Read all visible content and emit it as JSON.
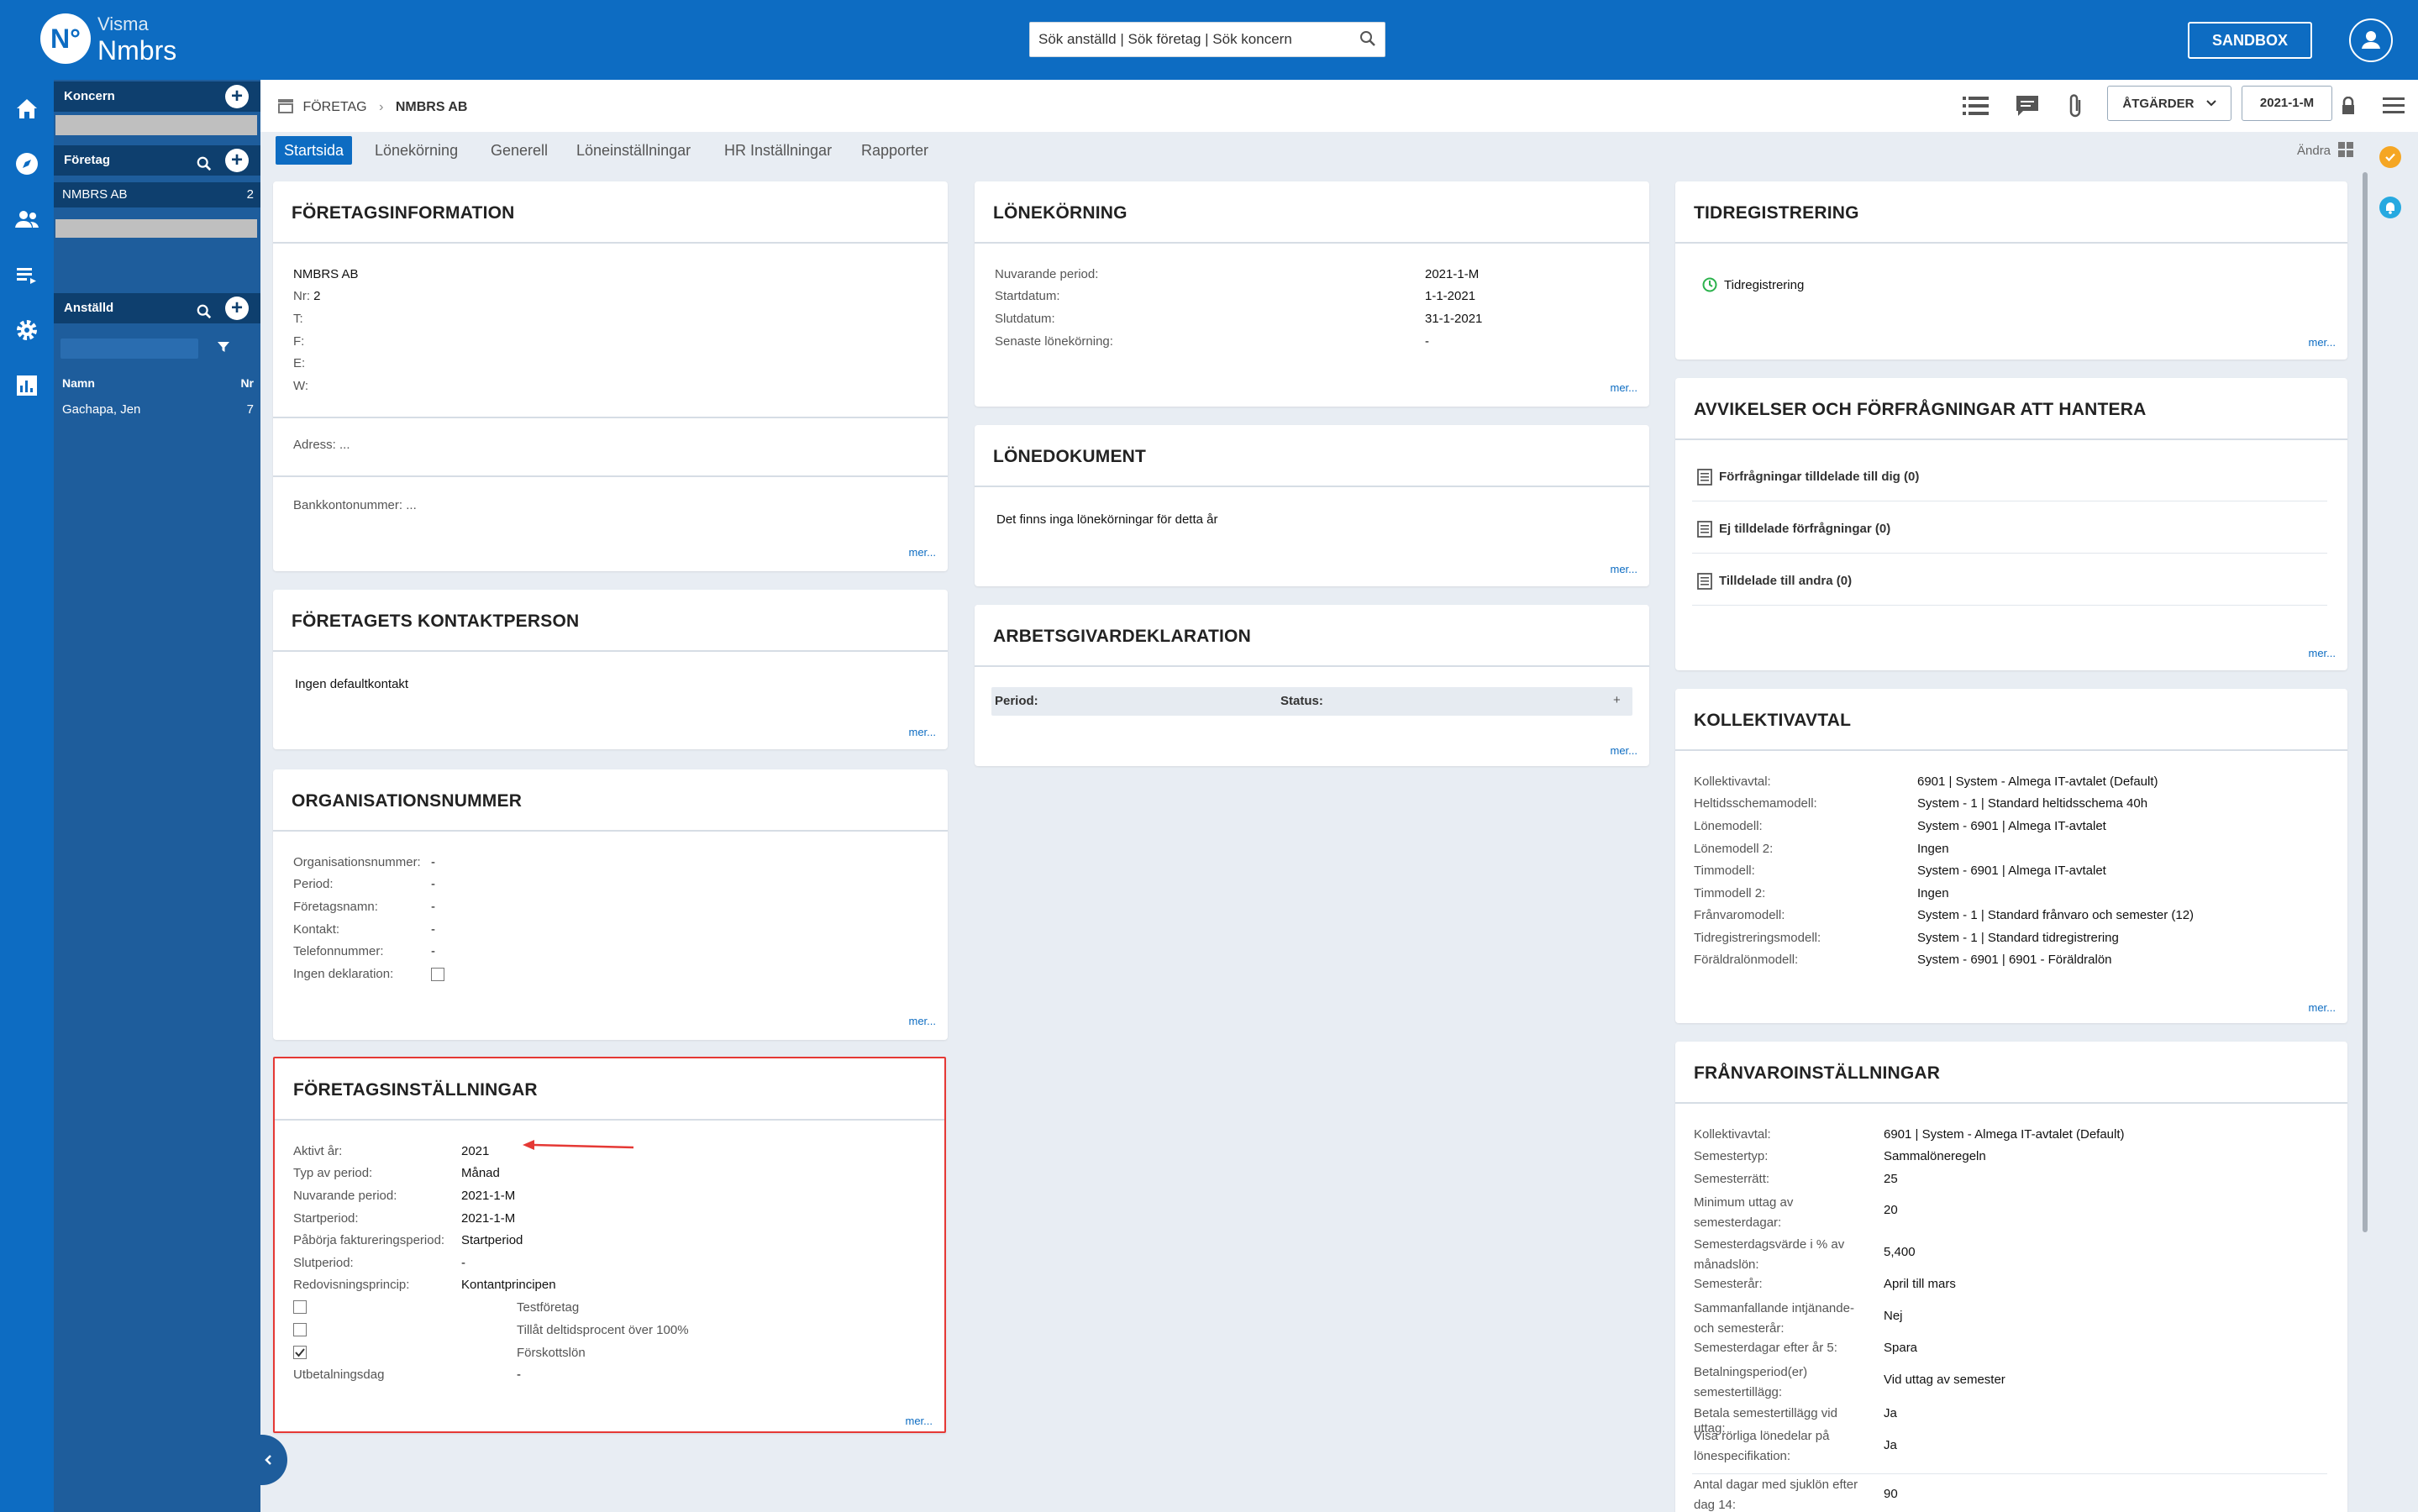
{
  "header": {
    "logo_mark": "N°",
    "logo_line1": "Visma",
    "logo_line2": "Nmbrs",
    "search_value": "Sök anställd | Sök företag | Sök koncern",
    "sandbox_label": "SANDBOX"
  },
  "sidebar": {
    "koncern_label": "Koncern",
    "foretag_label": "Företag",
    "company_name": "NMBRS AB",
    "company_nr": "2",
    "anstalld_label": "Anställd",
    "col_namn": "Namn",
    "col_nr": "Nr",
    "employee_name": "Gachapa, Jen",
    "employee_nr": "7"
  },
  "breadcrumb": {
    "root": "FÖRETAG",
    "sep": "›",
    "current": "NMBRS AB"
  },
  "toolbar": {
    "atgarder_label": "ÅTGÄRDER",
    "period_label": "2021-1-M"
  },
  "tabs": [
    "Startsida",
    "Lönekörning",
    "Generell",
    "Löneinställningar",
    "HR Inställningar",
    "Rapporter"
  ],
  "andra_label": "Ändra",
  "mer": "mer...",
  "foretagsinfo": {
    "title": "FÖRETAGSINFORMATION",
    "name": "NMBRS AB",
    "nr_label": "Nr:",
    "nr_value": "2",
    "t": "T:",
    "f": "F:",
    "e": "E:",
    "w": "W:",
    "adress": "Adress: ...",
    "bank": "Bankkontonummer: ..."
  },
  "kontaktperson": {
    "title": "FÖRETAGETS KONTAKTPERSON",
    "text": "Ingen defaultkontakt"
  },
  "orgnummer": {
    "title": "ORGANISATIONSNUMMER",
    "rows": [
      {
        "label": "Organisationsnummer:",
        "value": "-"
      },
      {
        "label": "Period:",
        "value": "-"
      },
      {
        "label": "Företagsnamn:",
        "value": "-"
      },
      {
        "label": "Kontakt:",
        "value": "-"
      },
      {
        "label": "Telefonnummer:",
        "value": "-"
      },
      {
        "label": "Ingen deklaration:",
        "value": ""
      }
    ]
  },
  "foretagsinst": {
    "title": "FÖRETAGSINSTÄLLNINGAR",
    "rows": [
      {
        "label": "Aktivt år:",
        "value": "2021"
      },
      {
        "label": "Typ av period:",
        "value": "Månad"
      },
      {
        "label": "Nuvarande period:",
        "value": "2021-1-M"
      },
      {
        "label": "Startperiod:",
        "value": "2021-1-M"
      },
      {
        "label": "Påbörja faktureringsperiod:",
        "value": "Startperiod"
      },
      {
        "label": "Slutperiod:",
        "value": "-"
      },
      {
        "label": "Redovisningsprincip:",
        "value": "Kontantprincipen"
      }
    ],
    "checks": [
      {
        "label": "Testföretag",
        "checked": false
      },
      {
        "label": "Tillåt deltidsprocent över 100%",
        "checked": false
      },
      {
        "label": "Förskottslön",
        "checked": true
      }
    ],
    "utbet_label": "Utbetalningsdag",
    "utbet_value": "-"
  },
  "lonekorning": {
    "title": "LÖNEKÖRNING",
    "rows": [
      {
        "label": "Nuvarande period:",
        "value": "2021-1-M"
      },
      {
        "label": "Startdatum:",
        "value": "1-1-2021"
      },
      {
        "label": "Slutdatum:",
        "value": "31-1-2021"
      },
      {
        "label": "Senaste lönekörning:",
        "value": "-"
      }
    ]
  },
  "lonedokument": {
    "title": "LÖNEDOKUMENT",
    "text": "Det finns inga lönekörningar för detta år"
  },
  "arbetsgivardekl": {
    "title": "ARBETSGIVARDEKLARATION",
    "period_label": "Period:",
    "status_label": "Status:",
    "plus": "+"
  },
  "tidregistrering": {
    "title": "TIDREGISTRERING",
    "item": "Tidregistrering"
  },
  "avvikelser": {
    "title": "AVVIKELSER OCH FÖRFRÅGNINGAR ATT HANTERA",
    "items": [
      "Förfrågningar tilldelade till dig (0)",
      "Ej tilldelade förfrågningar (0)",
      "Tilldelade till andra (0)"
    ]
  },
  "kollektivavtal": {
    "title": "KOLLEKTIVAVTAL",
    "rows": [
      {
        "label": "Kollektivavtal:",
        "value": "6901 | System - Almega IT-avtalet (Default)"
      },
      {
        "label": "Heltidsschemamodell:",
        "value": "System - 1 | Standard heltidsschema 40h"
      },
      {
        "label": "Lönemodell:",
        "value": "System - 6901 | Almega IT-avtalet"
      },
      {
        "label": "Lönemodell 2:",
        "value": "Ingen"
      },
      {
        "label": "Timmodell:",
        "value": "System - 6901 | Almega IT-avtalet"
      },
      {
        "label": "Timmodell 2:",
        "value": "Ingen"
      },
      {
        "label": "Frånvaromodell:",
        "value": "System - 1 | Standard frånvaro och semester (12)"
      },
      {
        "label": "Tidregistreringsmodell:",
        "value": "System - 1 | Standard tidregistrering"
      },
      {
        "label": "Föräldralönmodell:",
        "value": "System - 6901 | 6901 - Föräldralön"
      }
    ]
  },
  "franvaro": {
    "title": "FRÅNVAROINSTÄLLNINGAR",
    "rows": [
      {
        "label": "Kollektivavtal:",
        "value": "6901 | System - Almega IT-avtalet (Default)"
      },
      {
        "label": "Semestertyp:",
        "value": "Sammalöneregeln"
      },
      {
        "label": "Semesterrätt:",
        "value": "25"
      },
      {
        "label": "Minimum uttag av semesterdagar:",
        "value": "20"
      },
      {
        "label": "Semesterdagsvärde i % av månadslön:",
        "value": "5,400"
      },
      {
        "label": "Semesterår:",
        "value": "April till mars"
      },
      {
        "label": "Sammanfallande intjänande- och semesterår:",
        "value": "Nej"
      },
      {
        "label": "Semesterdagar efter år 5:",
        "value": "Spara"
      },
      {
        "label": "Betalningsperiod(er) semestertillägg:",
        "value": "Vid uttag av semester"
      },
      {
        "label": "Betala semestertillägg vid uttag:",
        "value": "Ja"
      },
      {
        "label": "Visa rörliga lönedelar på lönespecifikation:",
        "value": "Ja"
      },
      {
        "label": "Antal dagar med sjuklön efter dag 14:",
        "value": "90"
      }
    ]
  }
}
